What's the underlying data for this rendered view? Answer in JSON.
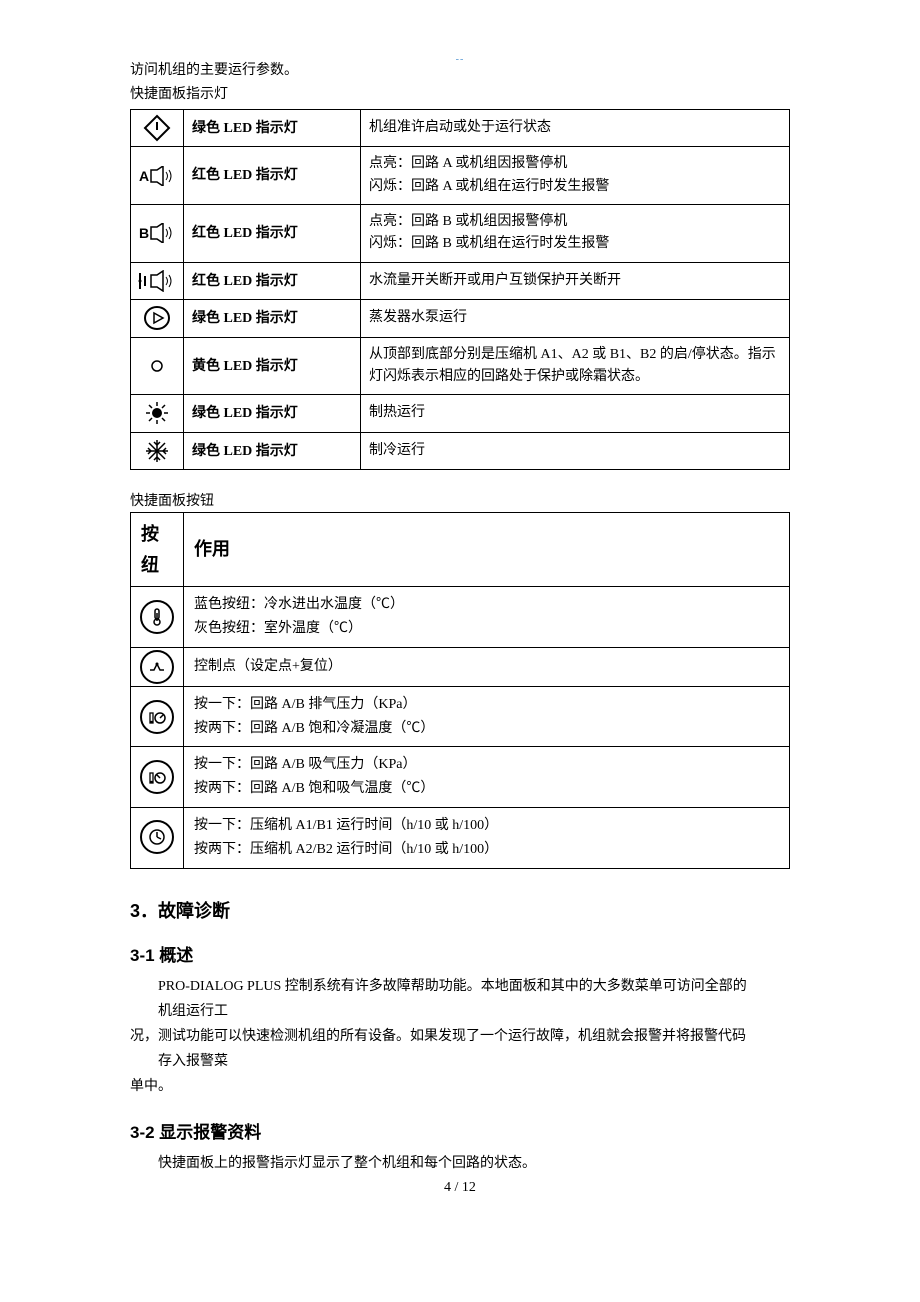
{
  "header_mark": "--",
  "intro_line1": "访问机组的主要运行参数。",
  "intro_line2": "快捷面板指示灯",
  "table1": {
    "rows": [
      {
        "icon": "diamond-power-icon",
        "led_cn_pre": "绿色",
        "led_en": " LED ",
        "led_cn_post": "指示灯",
        "desc": "机组准许启动或处于运行状态"
      },
      {
        "icon": "a-speaker-icon",
        "led_cn_pre": "红色",
        "led_en": " LED ",
        "led_cn_post": "指示灯",
        "desc_l1": "点亮：回路 A 或机组因报警停机",
        "desc_l2": "闪烁：回路 A 或机组在运行时发生报警"
      },
      {
        "icon": "b-speaker-icon",
        "led_cn_pre": "红色",
        "led_en": " LED ",
        "led_cn_post": "指示灯",
        "desc_l1": "点亮：回路 B 或机组因报警停机",
        "desc_l2": "闪烁：回路 B 或机组在运行时发生报警"
      },
      {
        "icon": "flow-speaker-icon",
        "led_cn_pre": "红色",
        "led_en": " LED ",
        "led_cn_post": "指示灯",
        "desc": "水流量开关断开或用户互锁保护开关断开"
      },
      {
        "icon": "play-circle-icon",
        "led_cn_pre": "绿色",
        "led_en": " LED ",
        "led_cn_post": "指示灯",
        "desc": "蒸发器水泵运行"
      },
      {
        "icon": "small-circle-icon",
        "led_cn_pre": "黄色",
        "led_en": " LED ",
        "led_cn_post": "指示灯",
        "desc": "从顶部到底部分别是压缩机 A1、A2 或 B1、B2 的启/停状态。指示灯闪烁表示相应的回路处于保护或除霜状态。"
      },
      {
        "icon": "sun-icon",
        "led_cn_pre": "绿色",
        "led_en": " LED ",
        "led_cn_post": "指示灯",
        "desc": "制热运行"
      },
      {
        "icon": "snowflake-icon",
        "led_cn_pre": "绿色",
        "led_en": " LED ",
        "led_cn_post": "指示灯",
        "desc": "制冷运行"
      }
    ]
  },
  "table2_title": "快捷面板按钮",
  "table2": {
    "header_btn": "按纽",
    "header_func": "作用",
    "rows": [
      {
        "icon": "thermometer-icon",
        "l1": "蓝色按纽：冷水进出水温度（℃）",
        "l2": "灰色按纽：室外温度（℃）"
      },
      {
        "icon": "setpoint-icon",
        "l1": "控制点（设定点+复位）"
      },
      {
        "icon": "gauge-discharge-icon",
        "l1": "按一下：回路 A/B 排气压力（KPa）",
        "l2": "按两下：回路 A/B 饱和冷凝温度（℃）"
      },
      {
        "icon": "gauge-suction-icon",
        "l1": "按一下：回路 A/B 吸气压力（KPa）",
        "l2": "按两下：回路 A/B 饱和吸气温度（℃）"
      },
      {
        "icon": "clock-icon",
        "l1": "按一下：压缩机 A1/B1 运行时间（h/10 或 h/100）",
        "l2": "按两下：压缩机 A2/B2 运行时间（h/10 或 h/100）"
      }
    ]
  },
  "section3_heading": "3．故障诊断",
  "section31_heading": "3-1 概述",
  "section31_p1a": "PRO-DIALOG PLUS 控制系统有许多故障帮助功能。本地面板和其中的大多数菜单可访问全部的",
  "section31_p1b": "机组运行工",
  "section31_p2a": "况，测试功能可以快速检测机组的所有设备。如果发现了一个运行故障，机组就会报警并将报警代码",
  "section31_p2b": "存入报警菜",
  "section31_p3": "单中。",
  "section32_heading": "3-2 显示报警资料",
  "section32_p1": "快捷面板上的报警指示灯显示了整个机组和每个回路的状态。",
  "page_number": "4 / 12"
}
